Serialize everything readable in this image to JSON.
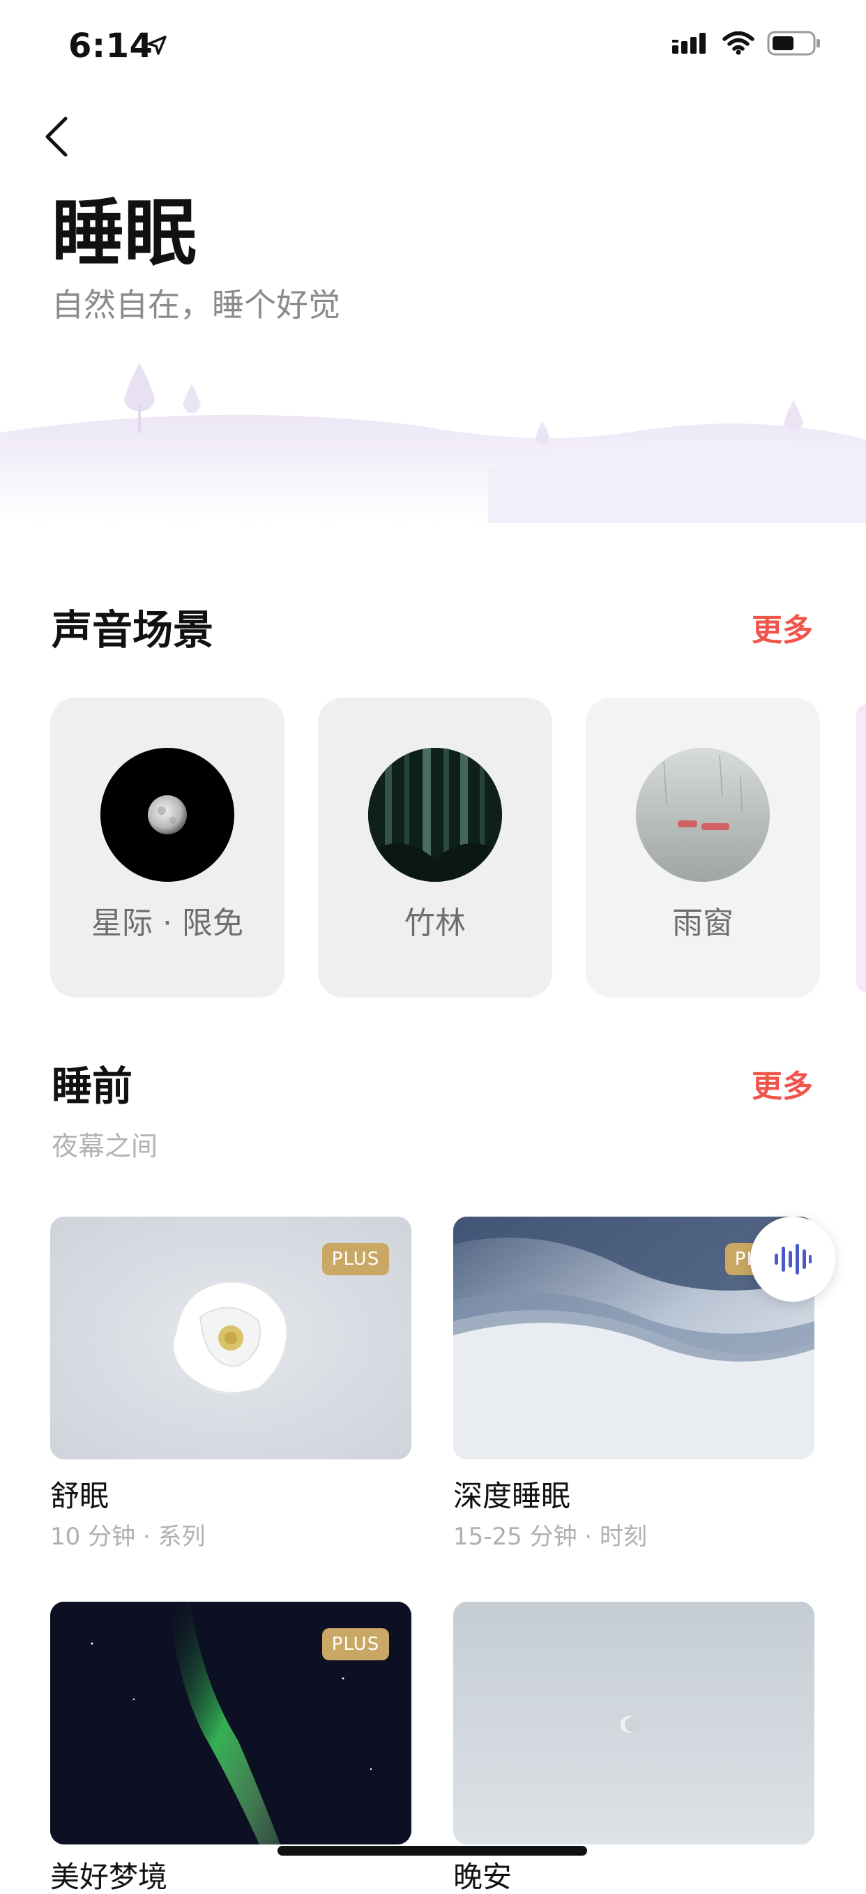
{
  "status_bar": {
    "time": "6:14"
  },
  "header": {
    "title": "睡眠",
    "subtitle": "自然自在，睡个好觉"
  },
  "sound_scenes": {
    "title": "声音场景",
    "more": "更多",
    "items": [
      {
        "label": "星际 · 限免"
      },
      {
        "label": "竹林"
      },
      {
        "label": "雨窗"
      }
    ]
  },
  "before_sleep": {
    "title": "睡前",
    "more": "更多",
    "subtitle": "夜幕之间",
    "cards": [
      {
        "badge": "PLUS",
        "title": "舒眠",
        "meta": "10 分钟 · 系列"
      },
      {
        "badge": "PLUS",
        "title": "深度睡眠",
        "meta": "15-25 分钟 · 时刻"
      },
      {
        "badge": "PLUS",
        "title": "美好梦境"
      },
      {
        "title": "晚安"
      }
    ]
  },
  "colors": {
    "accent": "#f0554c",
    "badge": "#c9a764",
    "fab_icon": "#4a58c8"
  }
}
